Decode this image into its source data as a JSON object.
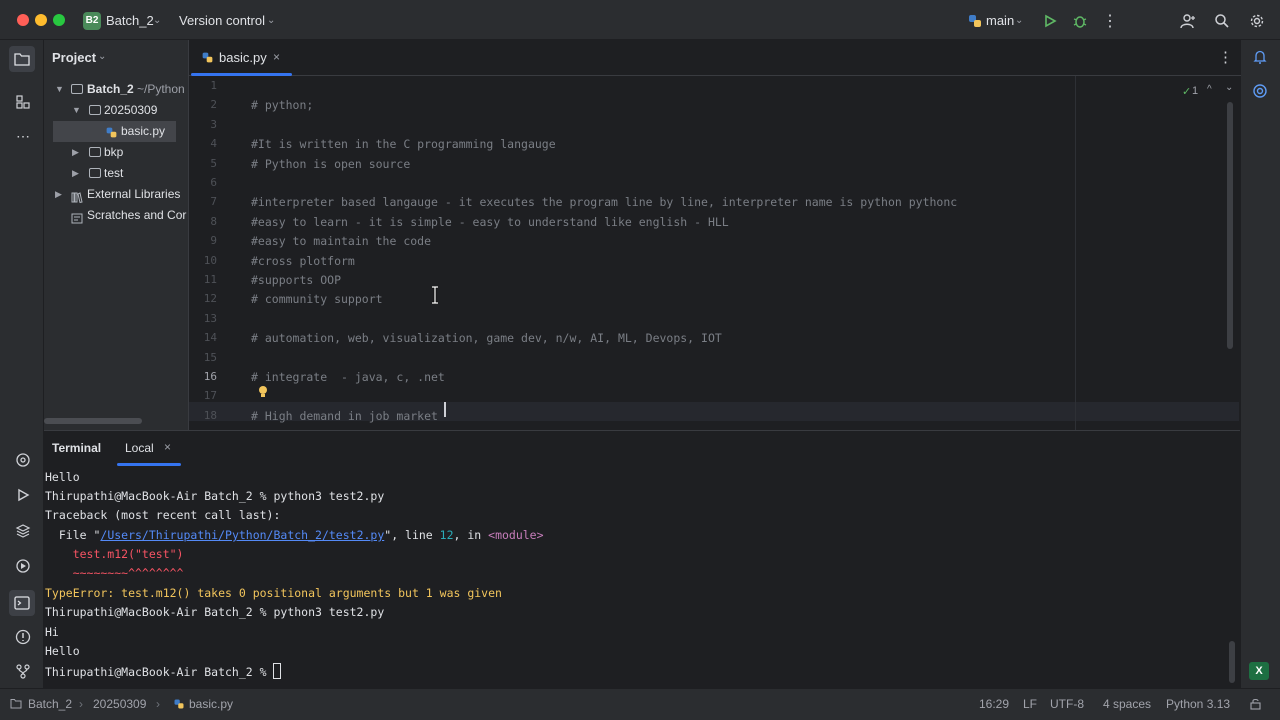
{
  "titlebar": {
    "project_badge": "B2",
    "project_name": "Batch_2",
    "vcs": "Version control",
    "branch": "main"
  },
  "project_panel": {
    "title": "Project",
    "items": [
      {
        "label": "Batch_2",
        "hint": "~/Python"
      },
      {
        "label": "20250309"
      },
      {
        "label": "basic.py"
      },
      {
        "label": "bkp"
      },
      {
        "label": "test"
      },
      {
        "label": "External Libraries"
      },
      {
        "label": "Scratches and Cor"
      }
    ]
  },
  "editor": {
    "tab_label": "basic.py",
    "inspection_count": "1",
    "line_numbers": [
      "1",
      "2",
      "3",
      "4",
      "5",
      "6",
      "7",
      "8",
      "9",
      "10",
      "11",
      "12",
      "13",
      "14",
      "15",
      "16",
      "17",
      "18"
    ],
    "lines": [
      "",
      "# python;",
      "",
      "#It is written in the C programming langauge",
      "# Python is open source",
      "",
      "#interpreter based langauge - it executes the program line by line, interpreter name is python pythonc",
      "#easy to learn - it is simple - easy to understand like english - HLL",
      "#easy to maintain the code",
      "#cross plotform",
      "#supports OOP",
      "# community support",
      "",
      "# automation, web, visualization, game dev, n/w, AI, ML, Devops, IOT",
      "",
      "# integrate  - java, c, .net",
      "",
      "# High demand in job market"
    ]
  },
  "terminal": {
    "tab_terminal": "Terminal",
    "tab_local": "Local",
    "line_hello1": "Hello",
    "line_cmd1": "Thirupathi@MacBook-Air Batch_2 % python3 test2.py",
    "line_traceback": "Traceback (most recent call last):",
    "file_prefix": "  File \"",
    "file_path": "/Users/Thirupathi/Python/Batch_2/test2.py",
    "file_mid": "\", line ",
    "file_lineno": "12",
    "file_in": ", in ",
    "file_module": "<module>",
    "code_line": "    test.m12(\"test\")",
    "caret_line": "    ~~~~~~~~^^^^^^^^",
    "error_type": "TypeError",
    "error_msg": ": test.m12() takes 0 positional arguments but 1 was given",
    "line_cmd2": "Thirupathi@MacBook-Air Batch_2 % python3 test2.py",
    "line_hi": "Hi",
    "line_hello2": "Hello",
    "line_prompt": "Thirupathi@MacBook-Air Batch_2 % "
  },
  "statusbar": {
    "crumb1": "Batch_2",
    "crumb2": "20250309",
    "crumb3": "basic.py",
    "position": "16:29",
    "line_sep": "LF",
    "encoding": "UTF-8",
    "indent": "4 spaces",
    "interpreter": "Python 3.13"
  },
  "colors": {
    "accent": "#3574f0",
    "error": "#f75464",
    "link": "#548af7",
    "warning": "#f2c55c"
  }
}
